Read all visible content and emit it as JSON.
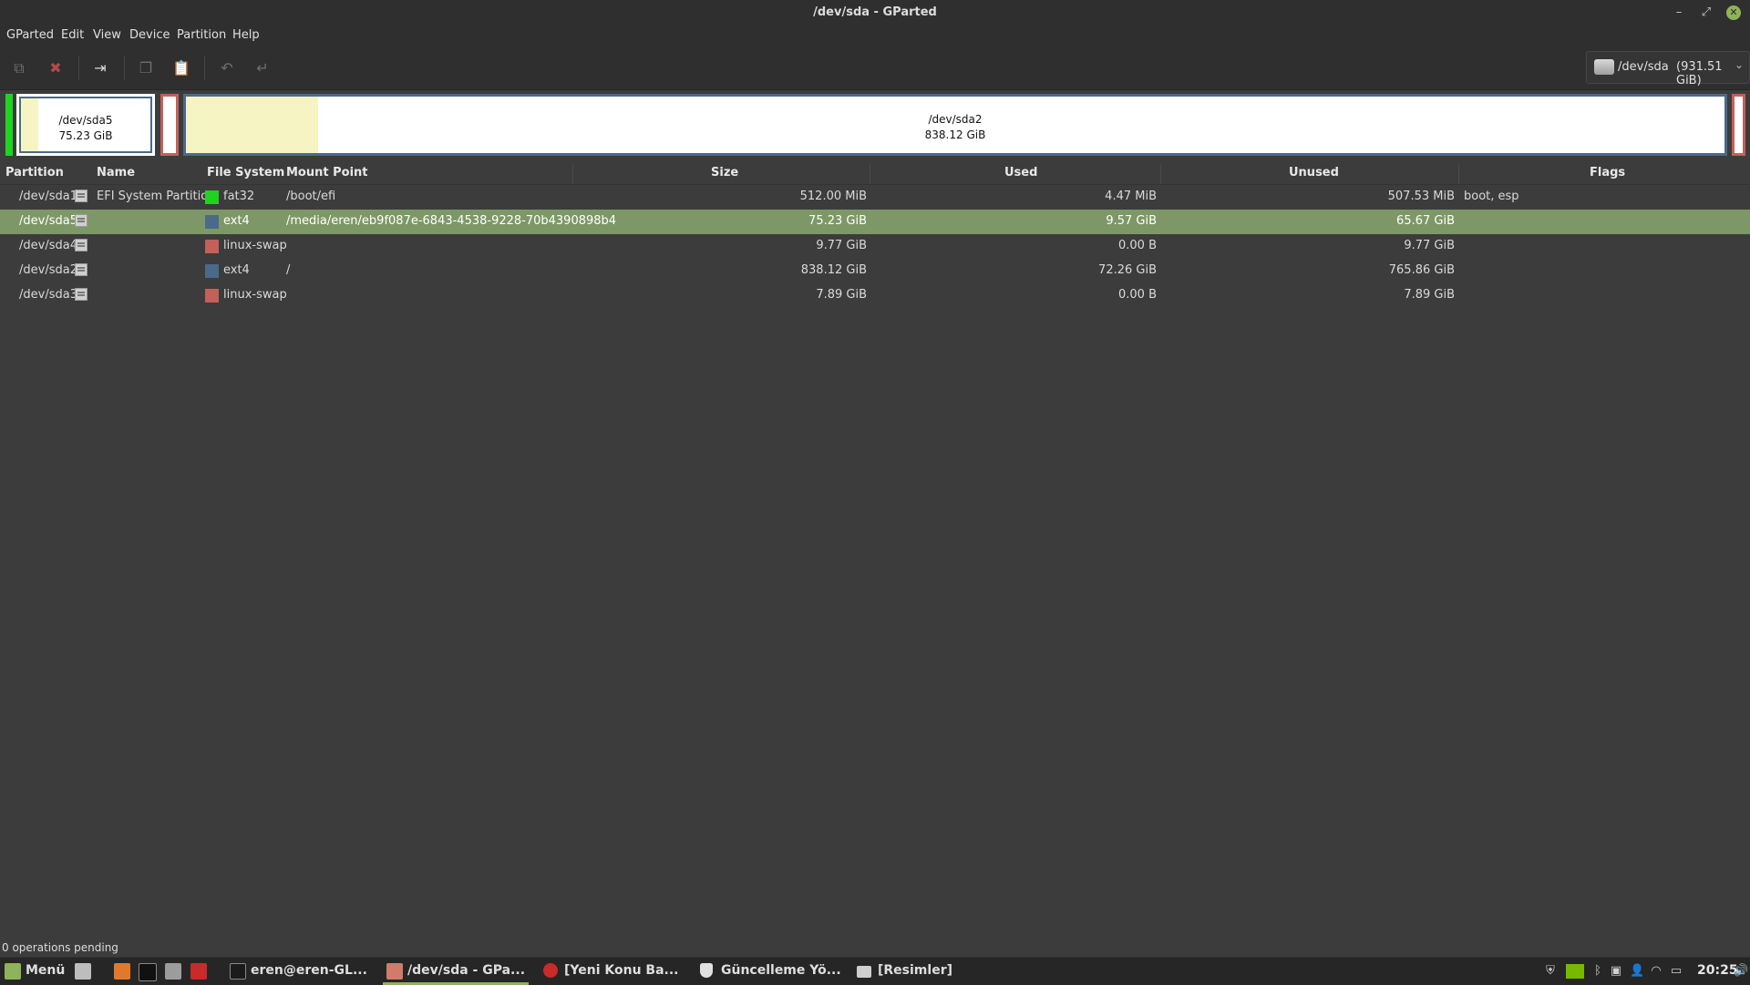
{
  "window": {
    "title": "/dev/sda - GParted"
  },
  "menu": [
    "GParted",
    "Edit",
    "View",
    "Device",
    "Partition",
    "Help"
  ],
  "device_selector": {
    "name": "/dev/sda",
    "size": "(931.51 GiB)"
  },
  "disk_map": {
    "sda5": {
      "name": "/dev/sda5",
      "size": "75.23 GiB",
      "used_fraction": 0.13
    },
    "sda2": {
      "name": "/dev/sda2",
      "size": "838.12 GiB",
      "used_fraction": 0.086
    }
  },
  "columns": {
    "partition": "Partition",
    "name": "Name",
    "file_system": "File System",
    "mount_point": "Mount Point",
    "size": "Size",
    "used": "Used",
    "unused": "Unused",
    "flags": "Flags"
  },
  "rows": [
    {
      "partition": "/dev/sda1",
      "name": "EFI System Partition",
      "fs": "fat32",
      "fs_color": "#1fd41f",
      "mount": "/boot/efi",
      "size": "512.00 MiB",
      "used": "4.47 MiB",
      "unused": "507.53 MiB",
      "flags": "boot, esp"
    },
    {
      "partition": "/dev/sda5",
      "name": "",
      "fs": "ext4",
      "fs_color": "#4a6a8a",
      "mount": "/media/eren/eb9f087e-6843-4538-9228-70b4390898b4",
      "size": "75.23 GiB",
      "used": "9.57 GiB",
      "unused": "65.67 GiB",
      "flags": ""
    },
    {
      "partition": "/dev/sda4",
      "name": "",
      "fs": "linux-swap",
      "fs_color": "#c4605a",
      "mount": "",
      "size": "9.77 GiB",
      "used": "0.00 B",
      "unused": "9.77 GiB",
      "flags": ""
    },
    {
      "partition": "/dev/sda2",
      "name": "",
      "fs": "ext4",
      "fs_color": "#4a6a8a",
      "mount": "/",
      "size": "838.12 GiB",
      "used": "72.26 GiB",
      "unused": "765.86 GiB",
      "flags": ""
    },
    {
      "partition": "/dev/sda3",
      "name": "",
      "fs": "linux-swap",
      "fs_color": "#c4605a",
      "mount": "",
      "size": "7.89 GiB",
      "used": "0.00 B",
      "unused": "7.89 GiB",
      "flags": ""
    }
  ],
  "selected_row": 1,
  "status": {
    "text": "0 operations pending"
  },
  "taskbar": {
    "menu_label": "Menü",
    "items": [
      {
        "label": "eren@eren-GL...",
        "icon": "terminal-icon"
      },
      {
        "label": "/dev/sda - GPa...",
        "icon": "gparted-icon"
      },
      {
        "label": "[Yeni Konu Ba...",
        "icon": "opera-icon"
      },
      {
        "label": "Güncelleme Yö...",
        "icon": "shield-icon"
      },
      {
        "label": "[Resimler]",
        "icon": "folder-icon"
      }
    ],
    "clock": "20:25"
  },
  "colors": {
    "accent": "#8fb35a",
    "selected_row": "#7d9866",
    "unallocated_border": "#c4605a",
    "fat32": "#1fd41f",
    "ext4": "#4a6a8a",
    "linux_swap": "#c4605a"
  }
}
